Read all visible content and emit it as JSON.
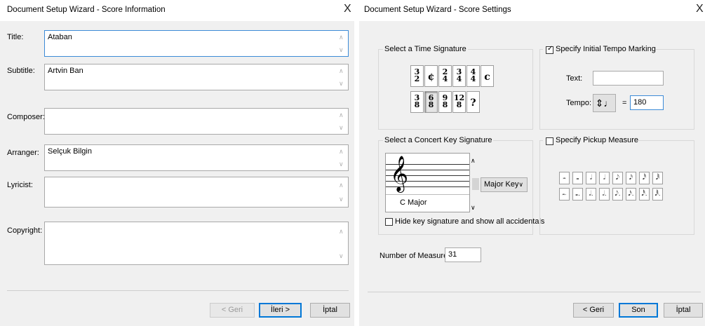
{
  "left": {
    "title": "Document Setup Wizard - Score Information",
    "close": "X",
    "fields": [
      {
        "label": "Title:",
        "value": "Ataban"
      },
      {
        "label": "Subtitle:",
        "value": "Artvin Ban"
      },
      {
        "label": "Composer:",
        "value": ""
      },
      {
        "label": "Arranger:",
        "value": "Selçuk Bilgin"
      },
      {
        "label": "Lyricist:",
        "value": ""
      },
      {
        "label": "Copyright:",
        "value": ""
      }
    ],
    "buttons": {
      "back": "< Geri",
      "next": "İleri >",
      "cancel": "İptal"
    }
  },
  "right": {
    "title": "Document Setup Wizard - Score Settings",
    "close": "X",
    "time_sig": {
      "group_label": "Select a Time Signature",
      "row1": [
        [
          "3",
          "2"
        ],
        [
          "¢",
          ""
        ],
        [
          "2",
          "4"
        ],
        [
          "3",
          "4"
        ],
        [
          "4",
          "4"
        ],
        [
          "c",
          ""
        ]
      ],
      "row2": [
        [
          "3",
          "8"
        ],
        [
          "6",
          "8"
        ],
        [
          "9",
          "8"
        ],
        [
          "12",
          "8"
        ],
        [
          "?",
          ""
        ]
      ],
      "selected": "6/8"
    },
    "key_sig": {
      "group_label": "Select a Concert Key Signature",
      "key_name": "C Major",
      "mode": "Major Key",
      "hide_label": "Hide key signature and show all accidentals",
      "hide_checked": false
    },
    "tempo": {
      "checkbox_label": "Specify Initial Tempo Marking",
      "checked": true,
      "text_label": "Text:",
      "text_value": "",
      "tempo_label": "Tempo:",
      "equals": "=",
      "tempo_value": "180"
    },
    "pickup": {
      "checkbox_label": "Specify Pickup Measure",
      "checked": false,
      "row1": [
        "𝅜",
        "𝅝",
        "𝅗𝅥",
        "𝅗𝅥",
        "𝅘𝅥𝅮",
        "𝅘𝅥𝅯",
        "𝅘𝅥𝅰",
        "𝅘𝅥𝅱"
      ],
      "row2": [
        "𝅜.",
        "𝅝.",
        "𝅗𝅥.",
        "𝅗𝅥.",
        "𝅘𝅥𝅮.",
        "𝅘𝅥𝅯.",
        "𝅘𝅥𝅰.",
        "𝅘𝅥𝅱."
      ]
    },
    "measures": {
      "label": "Number of Measures:",
      "value": "31"
    },
    "buttons": {
      "back": "< Geri",
      "finish": "Son",
      "cancel": "İptal"
    }
  },
  "colors": {
    "panel": "#f0f0f0",
    "focus": "#0078d7"
  }
}
